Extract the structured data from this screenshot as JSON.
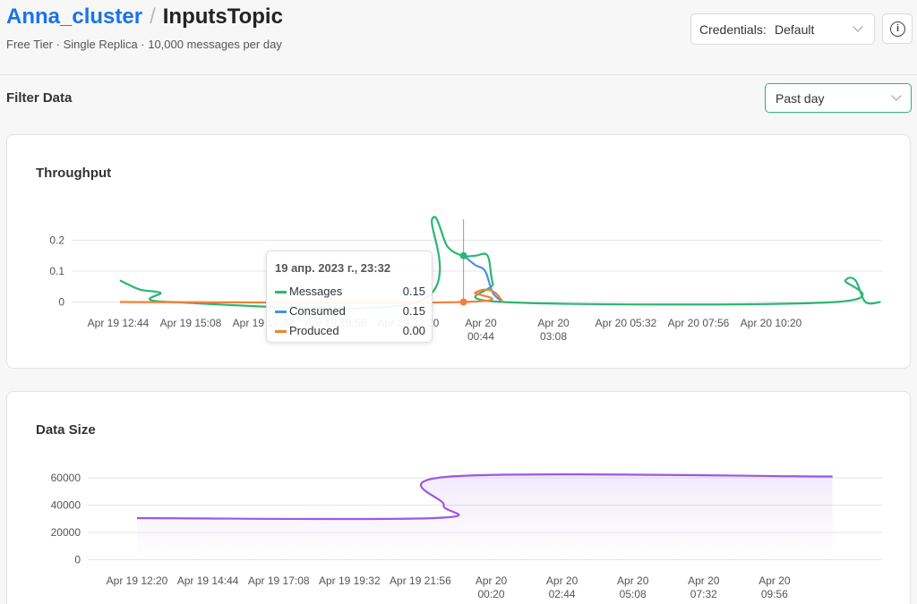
{
  "header": {
    "cluster": "Anna_cluster",
    "separator": "/",
    "topic": "InputsTopic",
    "subtitle": "Free Tier · Single Replica · 10,000 messages per day",
    "credentials_label": "Credentials:",
    "credentials_value": "Default",
    "info_symbol": "i"
  },
  "filter": {
    "title": "Filter Data",
    "range_value": "Past day"
  },
  "colors": {
    "messages": "#2bb673",
    "consumed": "#4a90e2",
    "produced": "#f28036",
    "datasize": "#9b59e6",
    "grid": "#e6e6e9",
    "tooltip_line": "#999999"
  },
  "icons": {
    "info": "info-circle-icon",
    "dropdown": "chevron-down-icon"
  },
  "throughput": {
    "title": "Throughput",
    "tooltip": {
      "title": "19 апр. 2023 г., 23:32",
      "rows": [
        {
          "name": "Messages",
          "value": "0.15"
        },
        {
          "name": "Consumed",
          "value": "0.15"
        },
        {
          "name": "Produced",
          "value": "0.00"
        }
      ]
    }
  },
  "datasize": {
    "title": "Data Size"
  },
  "chart_data": [
    {
      "type": "line",
      "title": "Throughput",
      "ylim": [
        0,
        0.2
      ],
      "yticks": [
        "0",
        "0.1",
        "0.2"
      ],
      "xticks": [
        [
          "Apr 19 12:44"
        ],
        [
          "Apr 19 15:08"
        ],
        [
          "Apr 19 17:32"
        ],
        [
          "Apr 19 19:56"
        ],
        [
          "Apr 19 22:20"
        ],
        [
          "Apr 20",
          "00:44"
        ],
        [
          "Apr 20",
          "03:08"
        ],
        [
          "Apr 20 05:32"
        ],
        [
          "Apr 20 07:56"
        ],
        [
          "Apr 20 10:20"
        ]
      ],
      "grid": true,
      "legend": "none",
      "series": [
        {
          "name": "Messages",
          "x": [
            "Apr 19 12:10",
            "Apr 19 12:50",
            "Apr 19 13:30",
            "Apr 19 13:50",
            "Apr 19 22:00",
            "Apr 19 22:30",
            "Apr 19 23:00",
            "Apr 19 23:30",
            "Apr 19 23:55",
            "Apr 20 00:20",
            "Apr 20 00:30",
            "Apr 20 00:50",
            "Apr 20 11:50",
            "Apr 20 12:10",
            "Apr 20 12:30",
            "Apr 20 12:50",
            "Apr 20 13:20"
          ],
          "y": [
            0.07,
            0.04,
            0.03,
            0,
            0,
            0.27,
            0.18,
            0.15,
            0.15,
            0.15,
            0.06,
            0,
            0,
            0.07,
            0.07,
            0,
            0
          ]
        },
        {
          "name": "Consumed",
          "x": [
            "Apr 19 23:25",
            "Apr 19 23:32",
            "Apr 19 23:55",
            "Apr 20 00:15",
            "Apr 20 00:30",
            "Apr 20 00:50"
          ],
          "y": [
            0.15,
            0.15,
            0.12,
            0.1,
            0.03,
            0
          ]
        },
        {
          "name": "Produced",
          "x": [
            "Apr 19 12:10",
            "Apr 19 23:32",
            "Apr 19 23:55",
            "Apr 20 00:15",
            "Apr 20 00:35",
            "Apr 20 00:50"
          ],
          "y": [
            0,
            0,
            0.03,
            0.04,
            0.03,
            0
          ]
        }
      ]
    },
    {
      "type": "area",
      "title": "Data Size",
      "ylim": [
        0,
        60000
      ],
      "yticks": [
        "0",
        "20000",
        "40000",
        "60000"
      ],
      "xticks": [
        [
          "Apr 19 12:20"
        ],
        [
          "Apr 19 14:44"
        ],
        [
          "Apr 19 17:08"
        ],
        [
          "Apr 19 19:32"
        ],
        [
          "Apr 19 21:56"
        ],
        [
          "Apr 20",
          "00:20"
        ],
        [
          "Apr 20",
          "02:44"
        ],
        [
          "Apr 20",
          "05:08"
        ],
        [
          "Apr 20",
          "07:32"
        ],
        [
          "Apr 20",
          "09:56"
        ]
      ],
      "grid": true,
      "legend": "none",
      "series": [
        {
          "x": [
            "Apr 19 13:30",
            "Apr 19 23:45",
            "Apr 20 00:05",
            "Apr 20 00:20",
            "Apr 20 13:30"
          ],
          "y": [
            30500,
            30500,
            40000,
            61000,
            61000
          ]
        }
      ]
    }
  ]
}
